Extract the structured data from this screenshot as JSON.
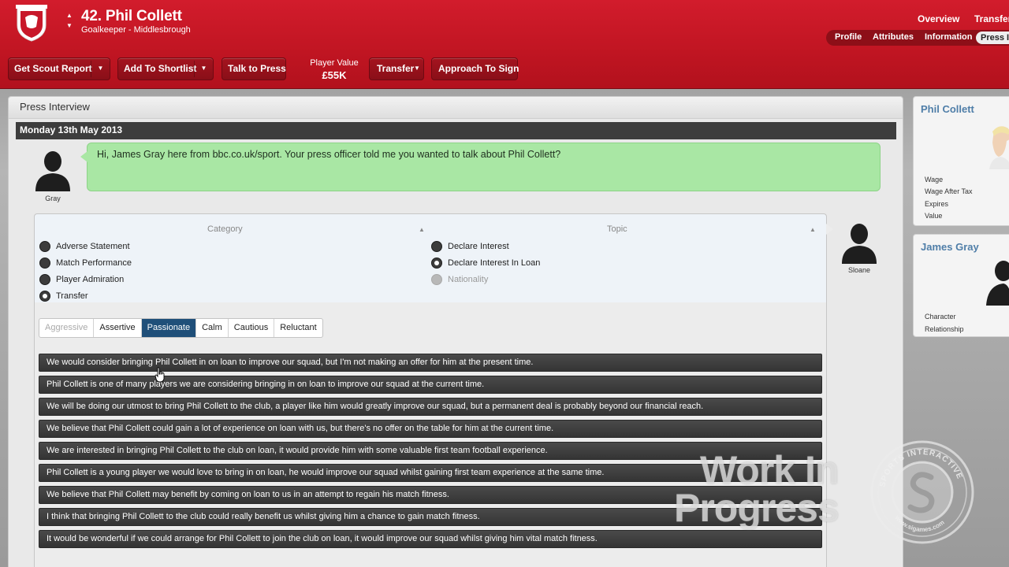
{
  "header": {
    "player_number_name": "42. Phil Collett",
    "player_subtitle": "Goalkeeper - Middlesbrough",
    "top_links": [
      "Overview",
      "Transfer"
    ],
    "sub_tabs": [
      "Profile",
      "Attributes",
      "Information",
      "Press I"
    ],
    "active_sub_tab": "Press I",
    "accent_color": "#c8182a"
  },
  "toolbar": {
    "scout_report": "Get Scout Report",
    "add_shortlist": "Add To Shortlist",
    "talk_press": "Talk to Press",
    "player_value_label": "Player Value",
    "player_value": "£55K",
    "transfer": "Transfer",
    "approach": "Approach To Sign"
  },
  "interview": {
    "panel_title": "Press Interview",
    "date": "Monday 13th May 2013",
    "journalist_name": "Gray",
    "question": "Hi, James Gray here from bbc.co.uk/sport. Your press officer told me you wanted to talk about Phil Collett?",
    "manager_name": "Sloane",
    "category_header": "Category",
    "topic_header": "Topic",
    "categories": [
      {
        "label": "Adverse Statement",
        "selected": false
      },
      {
        "label": "Match Performance",
        "selected": false
      },
      {
        "label": "Player Admiration",
        "selected": false
      },
      {
        "label": "Transfer",
        "selected": true
      }
    ],
    "topics": [
      {
        "label": "Declare Interest",
        "selected": false,
        "disabled": false
      },
      {
        "label": "Declare Interest In Loan",
        "selected": true,
        "disabled": false
      },
      {
        "label": "Nationality",
        "selected": false,
        "disabled": true
      }
    ],
    "tones": [
      {
        "label": "Aggressive",
        "state": "disabled"
      },
      {
        "label": "Assertive",
        "state": "normal"
      },
      {
        "label": "Passionate",
        "state": "active"
      },
      {
        "label": "Calm",
        "state": "normal"
      },
      {
        "label": "Cautious",
        "state": "normal"
      },
      {
        "label": "Reluctant",
        "state": "normal"
      }
    ],
    "responses": [
      "We would consider bringing Phil Collett in on loan to improve our squad, but I'm not making an offer for him at the present time.",
      "Phil Collett is one of many players we are considering bringing in on loan to improve our squad at the current time.",
      "We will be doing our utmost to bring Phil Collett to the club, a player like him would greatly improve our squad, but a permanent deal is probably beyond our financial reach.",
      "We believe that Phil Collett could gain a lot of experience on loan with us, but there's no offer on the table for him at the current time.",
      "We are interested in bringing Phil Collett to the club on loan, it would provide him with some valuable first team football experience.",
      "Phil Collett is a young player we would love to bring in on loan, he would improve our squad whilst gaining first team experience at the same time.",
      "We believe that Phil Collett may benefit by coming on loan to us in an attempt to regain his match fitness.",
      "I think that bringing Phil Collett to the club could really benefit us whilst giving him a chance to gain match fitness.",
      "It would be wonderful if we could arrange for Phil Collett to join the club on loan, it would improve our squad whilst giving him vital match fitness."
    ]
  },
  "sidebar": {
    "player_card": {
      "name": "Phil Collett",
      "rows": [
        "Wage",
        "Wage After Tax",
        "Expires",
        "Value"
      ]
    },
    "journalist_card": {
      "name": "James Gray",
      "rows": [
        "Character",
        "Relationship"
      ]
    }
  },
  "watermark": {
    "line1": "Work In",
    "line2": "Progress",
    "seal_top": "SPORTS INTERACTIVE",
    "seal_bottom": "www.sigames.com"
  }
}
